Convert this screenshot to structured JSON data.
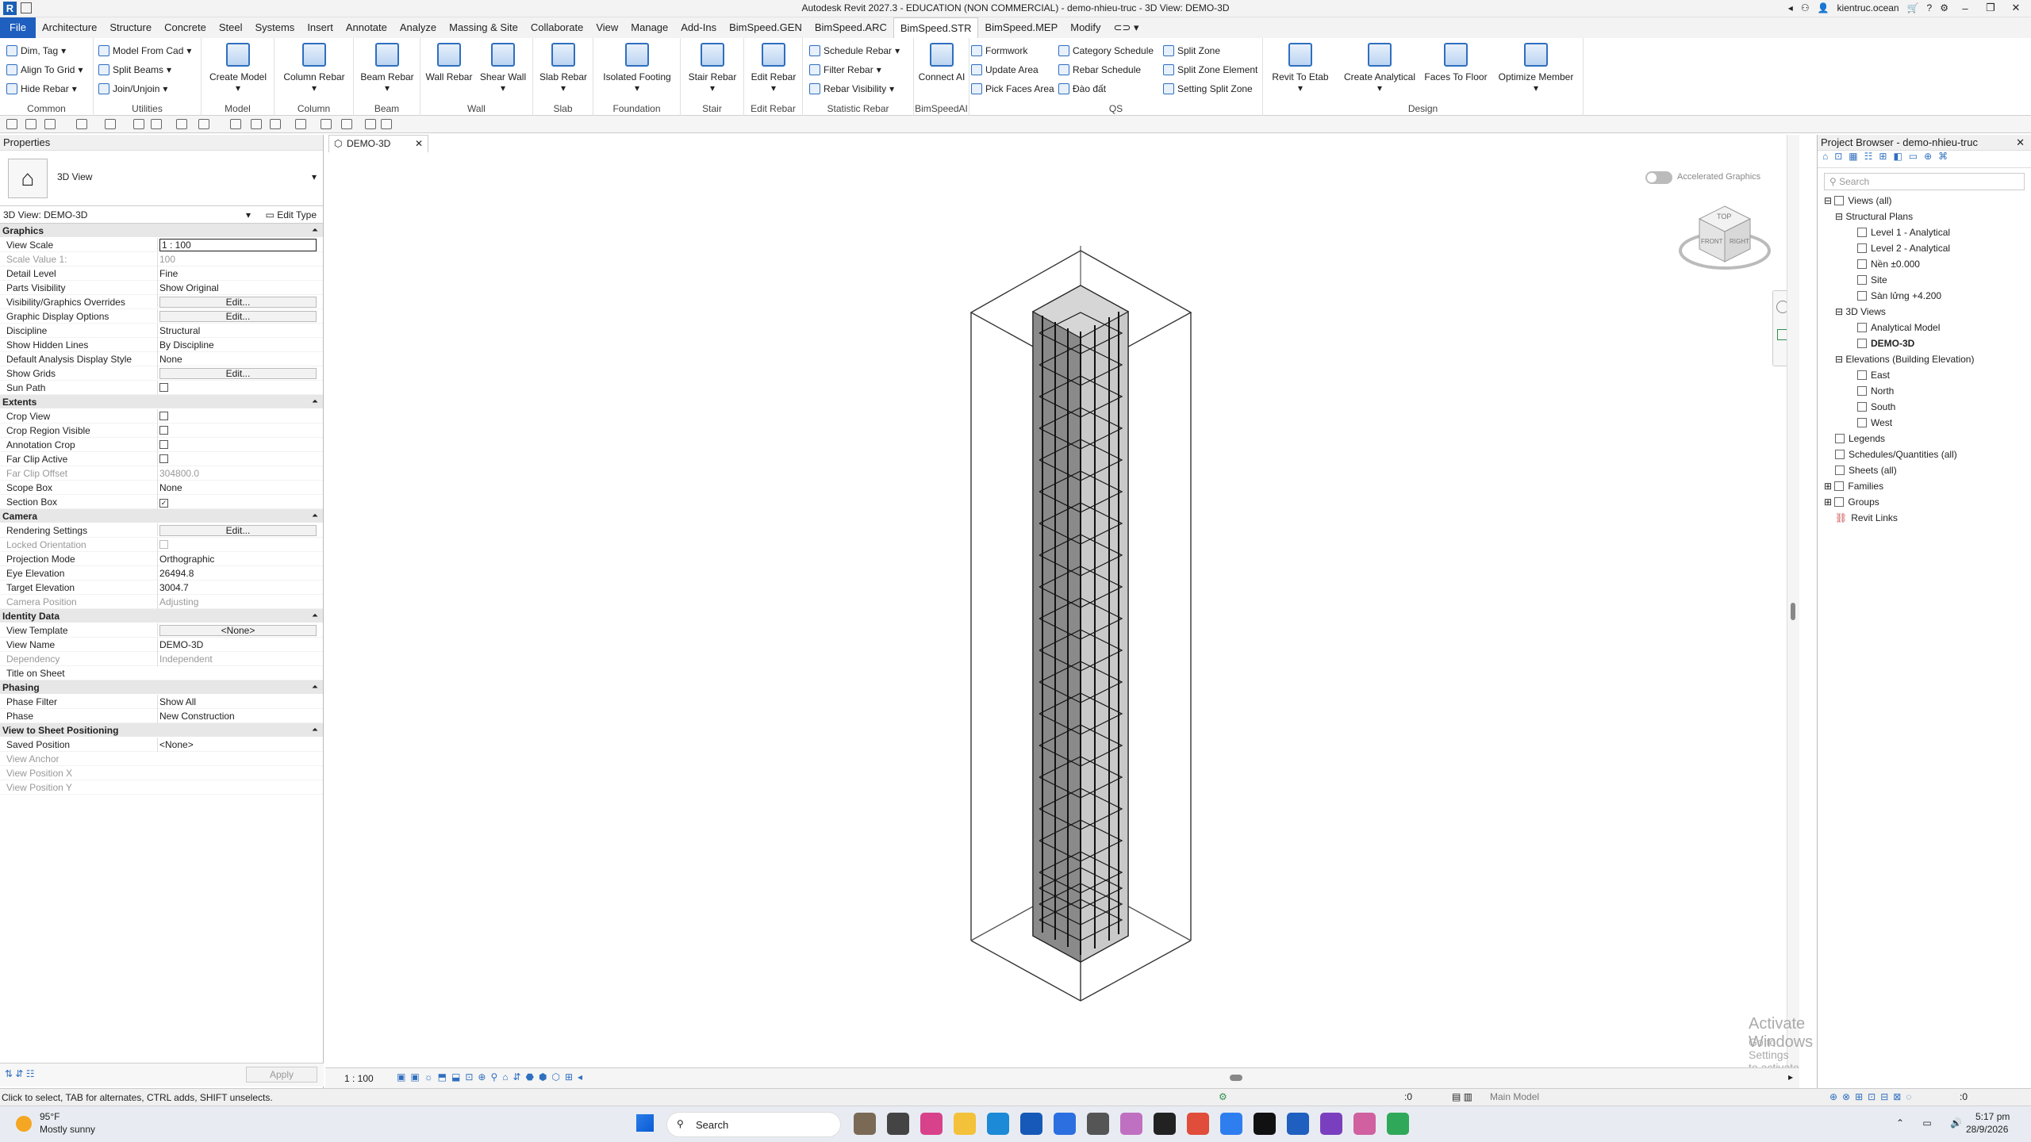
{
  "titlebar": {
    "title": "Autodesk Revit 2027.3 - EDUCATION (NON COMMERCIAL) - demo-nhieu-truc - 3D View: DEMO-3D",
    "user": "kientruc.ocean"
  },
  "menu": [
    "File",
    "Architecture",
    "Structure",
    "Concrete",
    "Steel",
    "Systems",
    "Insert",
    "Annotate",
    "Analyze",
    "Massing & Site",
    "Collaborate",
    "View",
    "Manage",
    "Add-Ins",
    "BimSpeed.GEN",
    "BimSpeed.ARC",
    "BimSpeed.STR",
    "BimSpeed.MEP",
    "Modify"
  ],
  "ribbon": {
    "common": {
      "label": "Common",
      "b1": "Dim, Tag",
      "b2": "Align To Grid",
      "b3": "Hide Rebar"
    },
    "utilities": {
      "label": "Utilities",
      "b1": "Model From Cad",
      "b2": "Split Beams",
      "b3": "Join/Unjoin"
    },
    "model": {
      "label": "Model",
      "btn": "Create Model"
    },
    "column": {
      "label": "Column",
      "btn": "Column Rebar"
    },
    "beam": {
      "label": "Beam",
      "btn": "Beam Rebar"
    },
    "wall": {
      "label": "Wall",
      "b1": "Wall Rebar",
      "b2": "Shear Wall"
    },
    "slab": {
      "label": "Slab",
      "btn": "Slab Rebar"
    },
    "foundation": {
      "label": "Foundation",
      "btn": "Isolated Footing"
    },
    "stair": {
      "label": "Stair",
      "btn": "Stair Rebar"
    },
    "editrebar": {
      "label": "Edit Rebar",
      "btn": "Edit Rebar"
    },
    "statistic": {
      "label": "Statistic Rebar",
      "b1": "Schedule Rebar",
      "b2": "Filter Rebar",
      "b3": "Rebar Visibility"
    },
    "bimspeedai": {
      "label": "BimSpeedAI",
      "btn": "Connect AI"
    },
    "qs": {
      "label": "QS",
      "b1": "Formwork",
      "b2": "Update Area",
      "b3": "Pick Faces Area",
      "b4": "Category Schedule",
      "b5": "Rebar Schedule",
      "b6": "Đào đất",
      "b7": "Split Zone",
      "b8": "Split Zone Element",
      "b9": "Setting Split Zone"
    },
    "design": {
      "label": "Design",
      "b1": "Revit To Etab",
      "b2": "Create Analytical",
      "b3": "Faces To Floor",
      "b4": "Optimize Member"
    }
  },
  "properties": {
    "header": "Properties",
    "type_name": "3D View",
    "view_selector": "3D View: DEMO-3D",
    "edit_type": "Edit Type",
    "graphics": {
      "label": "Graphics",
      "view_scale": "View Scale",
      "view_scale_v": "1 : 100",
      "scale_value": "Scale Value 1:",
      "scale_value_v": "100",
      "detail_level": "Detail Level",
      "detail_level_v": "Fine",
      "parts_vis": "Parts Visibility",
      "parts_vis_v": "Show Original",
      "vg": "Visibility/Graphics Overrides",
      "edit": "Edit...",
      "gdo": "Graphic Display Options",
      "discipline": "Discipline",
      "discipline_v": "Structural",
      "hidden": "Show Hidden Lines",
      "hidden_v": "By Discipline",
      "dads": "Default Analysis Display Style",
      "dads_v": "None",
      "grids": "Show Grids",
      "sun": "Sun Path"
    },
    "extents": {
      "label": "Extents",
      "crop": "Crop View",
      "crop_vis": "Crop Region Visible",
      "ann_crop": "Annotation Crop",
      "far_clip": "Far Clip Active",
      "far_off": "Far Clip Offset",
      "far_off_v": "304800.0",
      "scope": "Scope Box",
      "scope_v": "None",
      "section": "Section Box"
    },
    "camera": {
      "label": "Camera",
      "render": "Rendering Settings",
      "locked": "Locked Orientation",
      "proj": "Projection Mode",
      "proj_v": "Orthographic",
      "eye": "Eye Elevation",
      "eye_v": "26494.8",
      "target": "Target Elevation",
      "target_v": "3004.7",
      "campos": "Camera Position",
      "campos_v": "Adjusting"
    },
    "identity": {
      "label": "Identity Data",
      "template": "View Template",
      "template_v": "<None>",
      "vname": "View Name",
      "vname_v": "DEMO-3D",
      "dep": "Dependency",
      "dep_v": "Independent",
      "tos": "Title on Sheet"
    },
    "phasing": {
      "label": "Phasing",
      "filter": "Phase Filter",
      "filter_v": "Show All",
      "phase": "Phase",
      "phase_v": "New Construction"
    },
    "sheetpos": {
      "label": "View to Sheet Positioning",
      "saved": "Saved Position",
      "saved_v": "<None>",
      "anchor": "View Anchor",
      "posx": "View Position X",
      "posy": "View Position Y"
    },
    "apply": "Apply"
  },
  "view": {
    "tab": "DEMO-3D",
    "accel": "Accelerated Graphics",
    "scale": "1 : 100",
    "watermark1": "Activate Windows",
    "watermark2": "Go to Settings to activate Windows."
  },
  "viewcube": {
    "top": "TOP",
    "front": "FRONT",
    "right": "RIGHT"
  },
  "browser": {
    "header": "Project Browser - demo-nhieu-truc",
    "search": "Search",
    "items": [
      "Views (all)",
      "Structural Plans",
      "Level 1 - Analytical",
      "Level 2 - Analytical",
      "Nền ±0.000",
      "Site",
      "Sàn lửng +4.200",
      "3D Views",
      "Analytical Model",
      "DEMO-3D",
      "Elevations (Building Elevation)",
      "East",
      "North",
      "South",
      "West",
      "Legends",
      "Schedules/Quantities (all)",
      "Sheets (all)",
      "Families",
      "Groups",
      "Revit Links"
    ]
  },
  "status": {
    "hint": "Click to select, TAB for alternates, CTRL adds, SHIFT unselects.",
    "count": ":0",
    "model": "Main Model",
    "filter": ":0"
  },
  "taskbar": {
    "temp": "95°F",
    "weather": "Mostly sunny",
    "search": "Search",
    "time": "5:17 pm",
    "date": "28/9/2026"
  }
}
